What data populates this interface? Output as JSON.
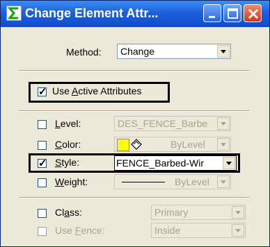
{
  "window": {
    "title": "Change Element Attr...",
    "colors": {
      "titlebar": "#1c5fdc",
      "close_button": "#cf3b14"
    }
  },
  "method": {
    "label": "Method:",
    "value": "Change"
  },
  "use_active": {
    "label_pre": "Use ",
    "label_key": "A",
    "label_post": "ctive Attributes",
    "checked": true
  },
  "attributes": {
    "level": {
      "label_key": "L",
      "label_rest": "evel:",
      "value": "DES_FENCE_Barbe",
      "checked": false
    },
    "color": {
      "label_key": "C",
      "label_rest": "olor:",
      "value": "ByLevel",
      "swatch": "#ffff00",
      "checked": false
    },
    "style": {
      "label_key": "S",
      "label_rest": "tyle:",
      "value": "FENCE_Barbed-Wir",
      "checked": true
    },
    "weight": {
      "label_key": "W",
      "label_rest": "eight:",
      "value": "ByLevel",
      "checked": false
    },
    "class": {
      "label_pre": "Cl",
      "label_key": "a",
      "label_post": "ss:",
      "value": "Primary",
      "checked": false
    },
    "use_fence": {
      "label_pre": "Use ",
      "label_key": "F",
      "label_post": "ence:",
      "value": "Inside",
      "checked": false
    }
  }
}
